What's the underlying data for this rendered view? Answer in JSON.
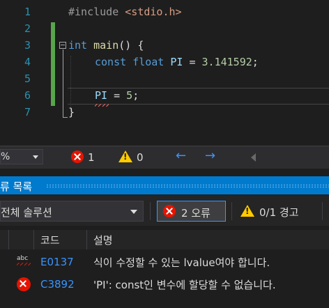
{
  "editor": {
    "line_numbers": [
      "1",
      "2",
      "3",
      "4",
      "5",
      "6",
      "7"
    ],
    "lines": {
      "l1_directive": "#include",
      "l1_header": "<stdio.h>",
      "l3_type": "int",
      "l3_name": "main",
      "l3_rest": "() {",
      "l4_kw1": "const",
      "l4_kw2": "float",
      "l4_var": "PI",
      "l4_eq": " = ",
      "l4_num": "3.141592",
      "l4_semi": ";",
      "l6_var": "PI",
      "l6_eq": " = ",
      "l6_num": "5",
      "l6_semi": ";",
      "l7_brace": "}"
    }
  },
  "status_strip": {
    "zoom": "%",
    "error_count": "1",
    "warning_count": "0",
    "back_arrow": "←",
    "forward_arrow": "→"
  },
  "error_list": {
    "title": "류 목록",
    "scope": "전체 솔루션",
    "errors_button": "2 오류",
    "warnings_button": "0/1 경고",
    "columns": {
      "code": "코드",
      "description": "설명"
    },
    "rows": [
      {
        "icon": "spelling-error-icon",
        "code": "E0137",
        "description": "식이 수정할 수 있는 lvalue여야 합니다."
      },
      {
        "icon": "error-icon",
        "code": "C3892",
        "description": "'PI': const인 변수에 할당할 수 없습니다."
      }
    ]
  },
  "colors": {
    "keyword": "#569cd6",
    "error": "#e51400",
    "accent": "#007acc",
    "link": "#3794ff",
    "change_bar": "#57a64a"
  }
}
